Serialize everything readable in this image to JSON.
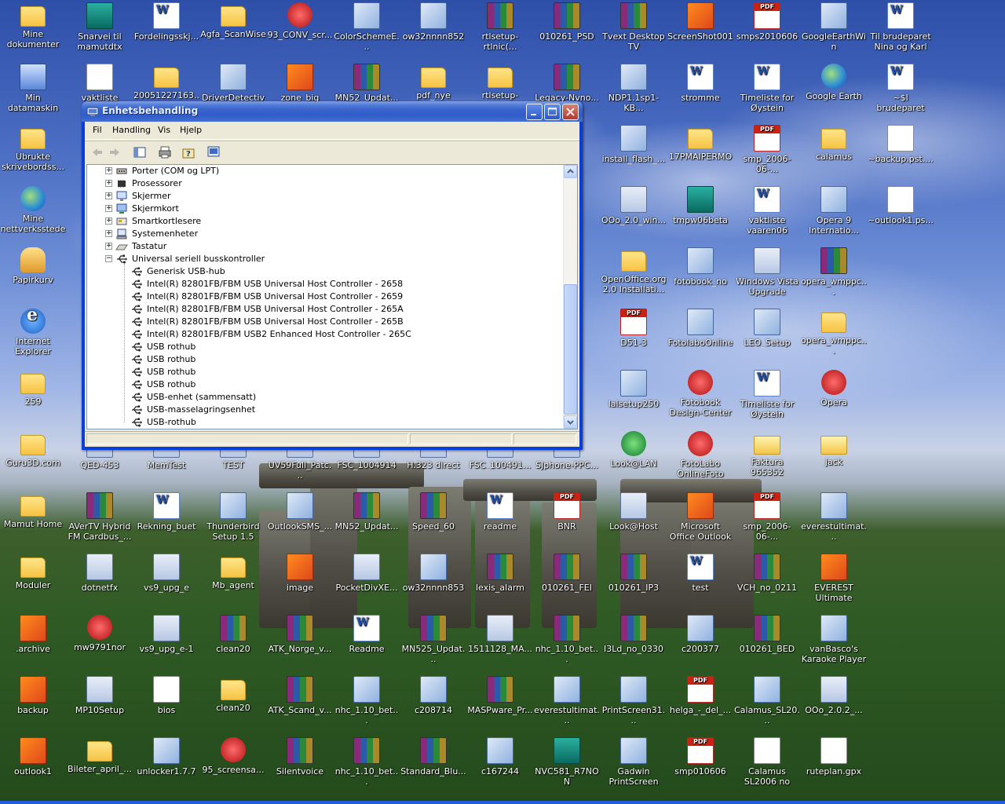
{
  "window": {
    "title": "Enhetsbehandling",
    "menu": [
      "Fil",
      "Handling",
      "Vis",
      "Hjelp"
    ],
    "tree": [
      {
        "label": "Porter (COM og LPT)",
        "level": 1,
        "expander": "+",
        "icon": "port-icon"
      },
      {
        "label": "Prosessorer",
        "level": 1,
        "expander": "+",
        "icon": "processor-icon"
      },
      {
        "label": "Skjermer",
        "level": 1,
        "expander": "+",
        "icon": "monitor-icon"
      },
      {
        "label": "Skjermkort",
        "level": 1,
        "expander": "+",
        "icon": "display-adapter-icon"
      },
      {
        "label": "Smartkortlesere",
        "level": 1,
        "expander": "+",
        "icon": "smartcard-icon"
      },
      {
        "label": "Systemenheter",
        "level": 1,
        "expander": "+",
        "icon": "system-icon"
      },
      {
        "label": "Tastatur",
        "level": 1,
        "expander": "+",
        "icon": "keyboard-icon"
      },
      {
        "label": "Universal seriell busskontroller",
        "level": 1,
        "expander": "−",
        "icon": "usb-icon"
      },
      {
        "label": "Generisk USB-hub",
        "level": 2,
        "icon": "usb-icon"
      },
      {
        "label": "Intel(R) 82801FB/FBM USB Universal Host Controller - 2658",
        "level": 2,
        "icon": "usb-icon"
      },
      {
        "label": "Intel(R) 82801FB/FBM USB Universal Host Controller - 2659",
        "level": 2,
        "icon": "usb-icon"
      },
      {
        "label": "Intel(R) 82801FB/FBM USB Universal Host Controller - 265A",
        "level": 2,
        "icon": "usb-icon"
      },
      {
        "label": "Intel(R) 82801FB/FBM USB Universal Host Controller - 265B",
        "level": 2,
        "icon": "usb-icon"
      },
      {
        "label": "Intel(R) 82801FB/FBM USB2 Enhanced Host Controller - 265C",
        "level": 2,
        "icon": "usb-icon"
      },
      {
        "label": "USB rothub",
        "level": 2,
        "icon": "usb-icon"
      },
      {
        "label": "USB rothub",
        "level": 2,
        "icon": "usb-icon"
      },
      {
        "label": "USB rothub",
        "level": 2,
        "icon": "usb-icon"
      },
      {
        "label": "USB rothub",
        "level": 2,
        "icon": "usb-icon"
      },
      {
        "label": "USB-enhet (sammensatt)",
        "level": 2,
        "icon": "usb-icon"
      },
      {
        "label": "USB-masselagringsenhet",
        "level": 2,
        "icon": "usb-icon"
      },
      {
        "label": "USB-rothub",
        "level": 2,
        "icon": "usb-icon"
      }
    ]
  },
  "desktop_icons": [
    {
      "label": "Mine dokumenter",
      "type": "folder"
    },
    {
      "label": "Snarvei til mamutdtx",
      "type": "teal"
    },
    {
      "label": "Fordelingsskj...",
      "type": "word"
    },
    {
      "label": "Agfa_ScanWise",
      "type": "folder"
    },
    {
      "label": "93_CONV_scr...",
      "type": "red"
    },
    {
      "label": "ColorSchemeE...",
      "type": "setup"
    },
    {
      "label": "ow32nnnn852",
      "type": "setup"
    },
    {
      "label": "rtlsetup-rtlnic(...",
      "type": "rar"
    },
    {
      "label": "010261_PSD",
      "type": "rar"
    },
    {
      "label": "Tvext Desktop TV",
      "type": "rar"
    },
    {
      "label": "ScreenShot001",
      "type": "office"
    },
    {
      "label": "smps2010606",
      "type": "pdf"
    },
    {
      "label": "GoogleEarthWin",
      "type": "setup"
    },
    {
      "label": "Til brudeparet Nina og Karl",
      "type": "word"
    },
    {
      "label": "Min datamaskin",
      "type": "comp"
    },
    {
      "label": "vaktliste",
      "type": "text"
    },
    {
      "label": "20051227163...",
      "type": "folder"
    },
    {
      "label": "DriverDetective",
      "type": "setup"
    },
    {
      "label": "zone_big",
      "type": "office"
    },
    {
      "label": "MN52_Updat...",
      "type": "rar"
    },
    {
      "label": "pdf_nye",
      "type": "folder"
    },
    {
      "label": "rtlsetup-rtlnic(...",
      "type": "folder"
    },
    {
      "label": "Legacy-Nvno...",
      "type": "rar"
    },
    {
      "label": "NDP1.1sp1-KB...",
      "type": "setup"
    },
    {
      "label": "stromme",
      "type": "word"
    },
    {
      "label": "Timeliste for Øystein Moltu...",
      "type": "word"
    },
    {
      "label": "Google Earth",
      "type": "globe"
    },
    {
      "label": "~$l brudeparet Nina og Karl",
      "type": "word"
    },
    {
      "label": "Ubrukte skrivebordss...",
      "type": "folder"
    },
    {
      "label": "install_flash_...",
      "type": "setup"
    },
    {
      "label": "17PMAIPERMO",
      "type": "folder"
    },
    {
      "label": "smp_2006-06-...",
      "type": "pdf"
    },
    {
      "label": "calamus",
      "type": "folder"
    },
    {
      "label": "~backup.pst....",
      "type": "text"
    },
    {
      "label": "Mine nettverkssteder",
      "type": "globe"
    },
    {
      "label": "OOo_2.0_win...",
      "type": "exe"
    },
    {
      "label": "tmpw06beta",
      "type": "teal"
    },
    {
      "label": "vaktliste vaaren06",
      "type": "word"
    },
    {
      "label": "Opera 9 Internatio...",
      "type": "setup"
    },
    {
      "label": "~outlook1.ps...",
      "type": "text"
    },
    {
      "label": "Papirkurv",
      "type": "recycle"
    },
    {
      "label": "OpenOffice.org 2.0 Installati...",
      "type": "folder"
    },
    {
      "label": "fotobook_no",
      "type": "setup"
    },
    {
      "label": "Windows Vista Upgrade Advisor",
      "type": "exe"
    },
    {
      "label": "opera_wmppc...",
      "type": "rar"
    },
    {
      "label": "Internet Explorer",
      "type": "ie"
    },
    {
      "label": "D51-3",
      "type": "pdf"
    },
    {
      "label": "FotolaboOnline",
      "type": "setup"
    },
    {
      "label": "LEO_Setup",
      "type": "setup"
    },
    {
      "label": "opera_wmppc...",
      "type": "folder"
    },
    {
      "label": "259",
      "type": "folder"
    },
    {
      "label": "lalsetup250",
      "type": "setup"
    },
    {
      "label": "Fotobook Design-Center",
      "type": "red"
    },
    {
      "label": "Timeliste for Øystein Moltu...",
      "type": "word"
    },
    {
      "label": "Opera",
      "type": "red"
    },
    {
      "label": "Guru3D.com",
      "type": "folder"
    },
    {
      "label": "QED-453",
      "type": "exe"
    },
    {
      "label": "MemTest",
      "type": "exe"
    },
    {
      "label": "TEST",
      "type": "exe"
    },
    {
      "label": "UV59Full_Patc...",
      "type": "exe"
    },
    {
      "label": "FSC_1004914",
      "type": "exe"
    },
    {
      "label": "H.323 direct",
      "type": "exe"
    },
    {
      "label": "FSC_100491...",
      "type": "exe"
    },
    {
      "label": "SJphone-PPC...",
      "type": "exe"
    },
    {
      "label": "Look@LAN",
      "type": "green"
    },
    {
      "label": "FotoLabo OnlineFoto",
      "type": "red"
    },
    {
      "label": "Faktura 965352",
      "type": "mail"
    },
    {
      "label": "jack",
      "type": "mail"
    },
    {
      "label": "Mamut Home",
      "type": "folder"
    },
    {
      "label": "AVerTV Hybrid FM Cardbus_...",
      "type": "rar"
    },
    {
      "label": "Rekning_buet",
      "type": "word"
    },
    {
      "label": "Thunderbird Setup 1.5",
      "type": "setup"
    },
    {
      "label": "OutlookSMS_...",
      "type": "setup"
    },
    {
      "label": "MN52_Updat...",
      "type": "rar"
    },
    {
      "label": "Speed_60",
      "type": "rar"
    },
    {
      "label": "readme",
      "type": "word"
    },
    {
      "label": "BNR",
      "type": "pdf"
    },
    {
      "label": "Look@Host",
      "type": "exe"
    },
    {
      "label": "Microsoft Office Outlook 2007...",
      "type": "office"
    },
    {
      "label": "smp_2006-06-...",
      "type": "pdf"
    },
    {
      "label": "everestultimat...",
      "type": "setup"
    },
    {
      "label": "Moduler",
      "type": "folder"
    },
    {
      "label": "dotnetfx",
      "type": "exe"
    },
    {
      "label": "vs9_upg_e",
      "type": "exe"
    },
    {
      "label": "Mb_agent",
      "type": "folder"
    },
    {
      "label": "image",
      "type": "office"
    },
    {
      "label": "PocketDivXE...",
      "type": "exe"
    },
    {
      "label": "ow32nnnn853",
      "type": "setup"
    },
    {
      "label": "lexis_alarm",
      "type": "rar"
    },
    {
      "label": "010261_FEI",
      "type": "rar"
    },
    {
      "label": "010261_IP3",
      "type": "rar"
    },
    {
      "label": "test",
      "type": "word"
    },
    {
      "label": "VCH_no_0211",
      "type": "rar"
    },
    {
      "label": "EVEREST Ultimate Edition",
      "type": "office"
    },
    {
      "label": ".archive",
      "type": "office"
    },
    {
      "label": "mw9791nor",
      "type": "red"
    },
    {
      "label": "vs9_upg_e-1",
      "type": "exe"
    },
    {
      "label": "clean20",
      "type": "rar"
    },
    {
      "label": "ATK_Norge_v...",
      "type": "rar"
    },
    {
      "label": "Readme",
      "type": "word"
    },
    {
      "label": "MN525_Updat...",
      "type": "rar"
    },
    {
      "label": "1511128_MA...",
      "type": "exe"
    },
    {
      "label": "nhc_1.10_bet...",
      "type": "rar"
    },
    {
      "label": "I3Ld_no_0330",
      "type": "rar"
    },
    {
      "label": "c200377",
      "type": "setup"
    },
    {
      "label": "010261_BED",
      "type": "rar"
    },
    {
      "label": "vanBasco's Karaoke Player",
      "type": "setup"
    },
    {
      "label": "backup",
      "type": "office"
    },
    {
      "label": "MP10Setup",
      "type": "exe"
    },
    {
      "label": "bios",
      "type": "text"
    },
    {
      "label": "clean20",
      "type": "folder"
    },
    {
      "label": "ATK_Scand_v...",
      "type": "rar"
    },
    {
      "label": "nhc_1.10_bet...",
      "type": "setup"
    },
    {
      "label": "c208714",
      "type": "setup"
    },
    {
      "label": "MASPware_Pr...",
      "type": "rar"
    },
    {
      "label": "everestultimat...",
      "type": "setup"
    },
    {
      "label": "PrintScreen31...",
      "type": "setup"
    },
    {
      "label": "helga_-_del_...",
      "type": "pdf"
    },
    {
      "label": "Calamus_SL20...",
      "type": "setup"
    },
    {
      "label": "OOo_2.0.2_...",
      "type": "exe"
    },
    {
      "label": "outlook1",
      "type": "office"
    },
    {
      "label": "Bileter_april_...",
      "type": "folder"
    },
    {
      "label": "unlocker1.7.7",
      "type": "setup"
    },
    {
      "label": "95_screensa...",
      "type": "red"
    },
    {
      "label": "Silentvoice",
      "type": "rar"
    },
    {
      "label": "nhc_1.10_bet...",
      "type": "rar"
    },
    {
      "label": "Standard_Blu...",
      "type": "rar"
    },
    {
      "label": "c167244",
      "type": "setup"
    },
    {
      "label": "NVC581_R7NON",
      "type": "teal"
    },
    {
      "label": "Gadwin PrintScreen",
      "type": "setup"
    },
    {
      "label": "smp010606",
      "type": "pdf"
    },
    {
      "label": "Calamus SL2006 no",
      "type": "text"
    },
    {
      "label": "ruteplan.gpx",
      "type": "text"
    }
  ]
}
